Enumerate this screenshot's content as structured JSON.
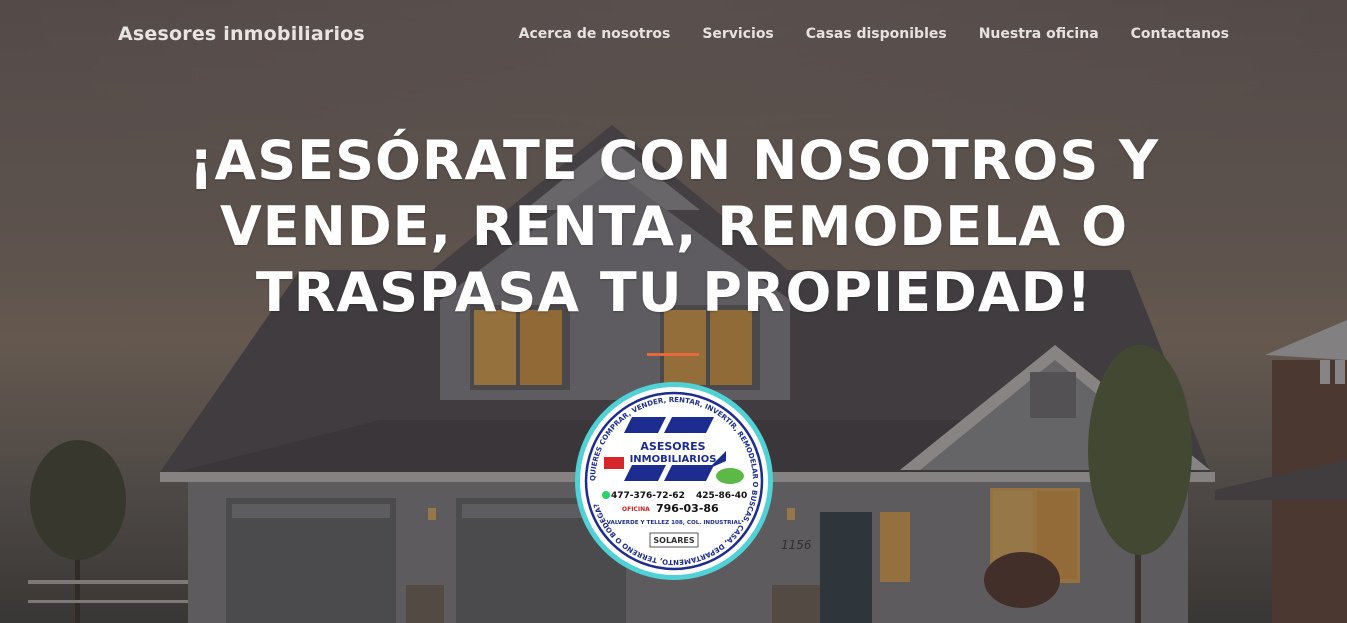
{
  "nav": {
    "brand": "Asesores inmobiliarios",
    "items": [
      {
        "label": "Acerca de nosotros"
      },
      {
        "label": "Servicios"
      },
      {
        "label": "Casas disponibles"
      },
      {
        "label": "Nuestra oficina"
      },
      {
        "label": "Contactanos"
      }
    ]
  },
  "hero": {
    "title": "¡ASESÓRATE CON NOSOTROS Y VENDE, RENTA, REMODELA O TRASPASA TU PROPIEDAD!",
    "accent_color": "#e56a3b"
  },
  "logo": {
    "ring_text": "QUIERES COMPRAR, VENDER, RENTAR, INVERTIR, REMODELAR O BUSCAS, CASA, DEPARTAMENTO, TERRENO O BODEGA?",
    "name_line1": "ASESORES",
    "name_line2": "INMOBILIARIOS",
    "phone_whatsapp": "477-376-72-62",
    "phone_2": "425-86-40",
    "office_label": "OFICINA",
    "office_phone": "796-03-86",
    "address": "VALVERDE Y TELLEZ 108, COL. INDUSTRIAL",
    "solares": "SOLARES"
  },
  "house": {
    "door_number": "1156"
  }
}
